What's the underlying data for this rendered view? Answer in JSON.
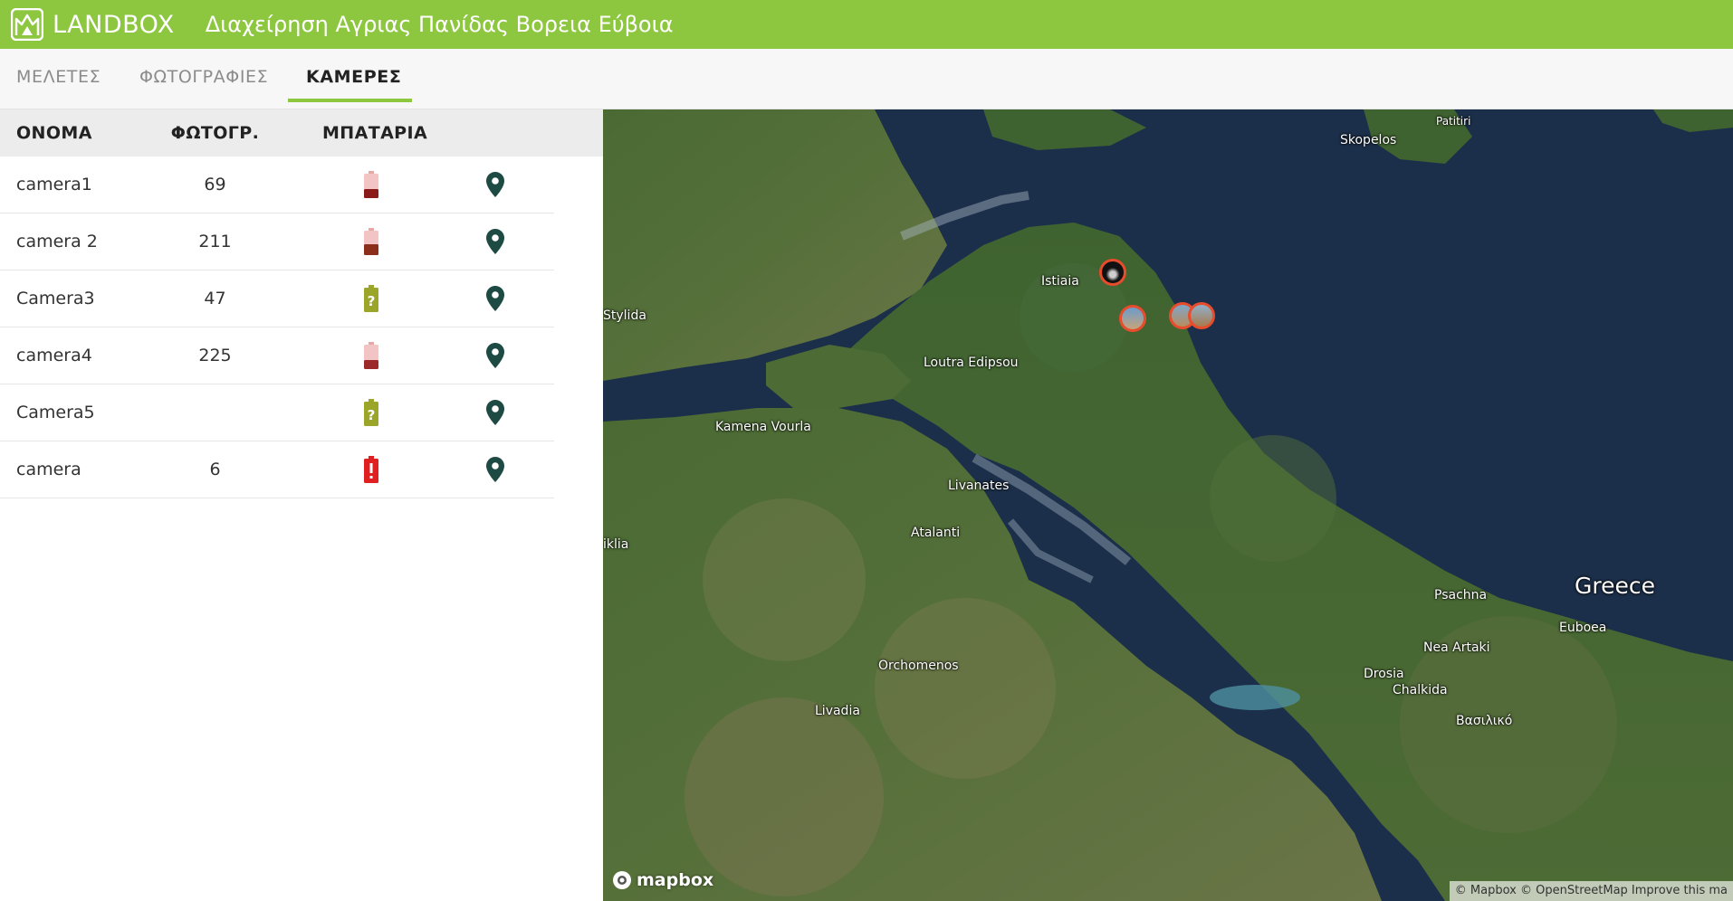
{
  "header": {
    "brand": "LANDBOX",
    "title": "Διαχείρηση Αγριας Πανίδας Βορεια Εύβοια",
    "color": "#8dc63f"
  },
  "tabs": [
    {
      "label": "ΜΕΛΕΤΕΣ",
      "active": false
    },
    {
      "label": "ΦΩΤΟΓΡΑΦΙΕΣ",
      "active": false
    },
    {
      "label": "ΚΑΜΕΡΕΣ",
      "active": true
    }
  ],
  "table": {
    "headers": {
      "name": "ΟΝΟΜΑ",
      "photos": "ΦΩΤΟΓΡ.",
      "battery": "ΜΠΑΤΑΡΙΑ"
    },
    "rows": [
      {
        "name": "camera1",
        "photos": "69",
        "battery": "low",
        "battery_icon": "battery-low-icon",
        "location_icon": "map-pin-icon"
      },
      {
        "name": "camera 2",
        "photos": "211",
        "battery": "low",
        "battery_icon": "battery-low-icon",
        "location_icon": "map-pin-icon"
      },
      {
        "name": "Camera3",
        "photos": "47",
        "battery": "unknown",
        "battery_icon": "battery-unknown-icon",
        "location_icon": "map-pin-icon"
      },
      {
        "name": "camera4",
        "photos": "225",
        "battery": "low",
        "battery_icon": "battery-low-icon",
        "location_icon": "map-pin-icon"
      },
      {
        "name": "Camera5",
        "photos": "",
        "battery": "unknown",
        "battery_icon": "battery-unknown-icon",
        "location_icon": "map-pin-icon"
      },
      {
        "name": "camera",
        "photos": "6",
        "battery": "alert",
        "battery_icon": "battery-alert-icon",
        "location_icon": "map-pin-icon"
      }
    ]
  },
  "map": {
    "places": [
      "Skopelos",
      "Patitiri",
      "Istiaia",
      "Stylida",
      "Loutra Edipsou",
      "Kamena Vourla",
      "Livanates",
      "Atalanti",
      "iklia",
      "Psachna",
      "Greece",
      "Euboea",
      "Nea Artaki",
      "Drosia",
      "Chalkida",
      "Βασιλικό",
      "Orchomenos",
      "Livadia"
    ],
    "logo": "mapbox",
    "attribution": "© Mapbox © OpenStreetMap Improve this ma"
  },
  "colors": {
    "accent": "#8dc63f",
    "pin": "#1e4a44",
    "battery_low": "#8b1a1a",
    "battery_unknown": "#9aa52a",
    "battery_alert": "#e02020",
    "marker_border": "#e74c2c"
  }
}
